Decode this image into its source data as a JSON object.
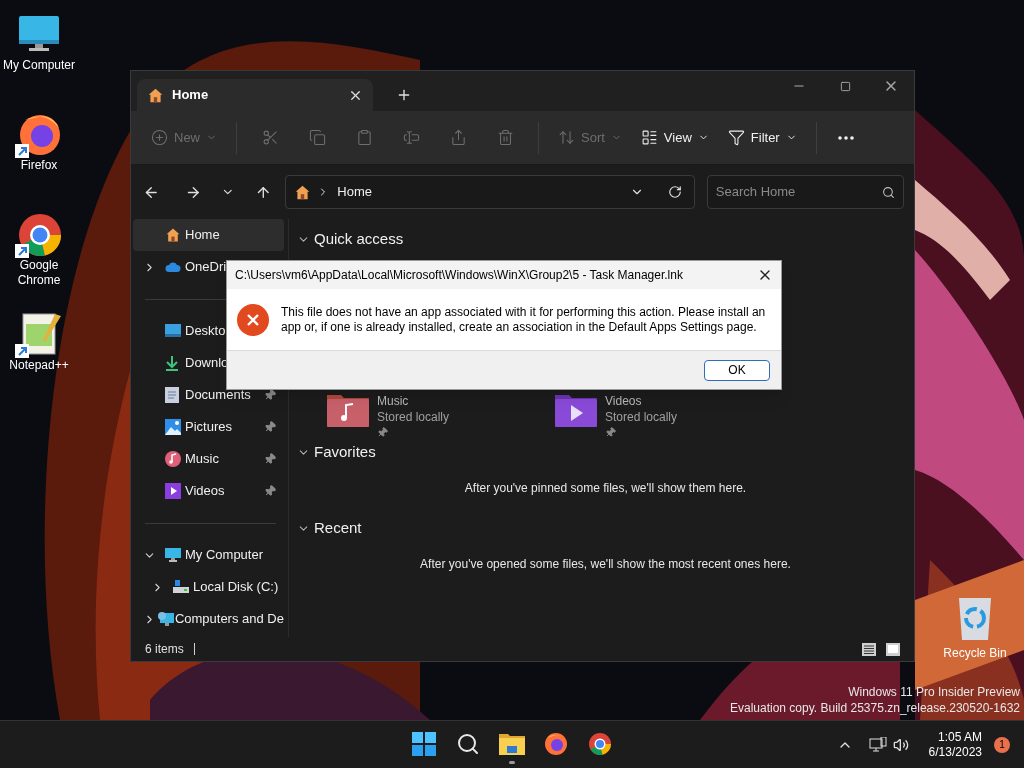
{
  "desktop_icons": [
    {
      "label": "My Computer",
      "kind": "monitor",
      "shortcut": false
    },
    {
      "label": "Firefox",
      "kind": "firefox",
      "shortcut": true
    },
    {
      "label": "Google Chrome",
      "kind": "chrome",
      "shortcut": true
    },
    {
      "label": "Notepad++",
      "kind": "notepad",
      "shortcut": true
    }
  ],
  "recycle_bin": {
    "label": "Recycle Bin"
  },
  "explorer": {
    "tab": {
      "title": "Home"
    },
    "toolbar": [
      {
        "kind": "new",
        "label": "New",
        "disabled": true
      },
      {
        "kind": "cut",
        "disabled": true
      },
      {
        "kind": "copy",
        "disabled": true
      },
      {
        "kind": "paste",
        "disabled": true
      },
      {
        "kind": "rename",
        "disabled": true
      },
      {
        "kind": "share",
        "disabled": true
      },
      {
        "kind": "delete",
        "disabled": true
      },
      {
        "kind": "sort",
        "label": "Sort",
        "disabled": true
      },
      {
        "kind": "view",
        "label": "View",
        "disabled": false
      },
      {
        "kind": "filter",
        "label": "Filter",
        "disabled": false
      },
      {
        "kind": "more",
        "disabled": false
      }
    ],
    "address": {
      "path": "Home"
    },
    "search": {
      "placeholder": "Search Home"
    },
    "sidebar": [
      {
        "items": [
          {
            "label": "Home",
            "kind": "home",
            "selected": true,
            "pinned": false
          },
          {
            "label": "OneDri",
            "kind": "cloud",
            "expanded": false,
            "selected": false,
            "pinned": false
          }
        ]
      },
      {
        "items": [
          {
            "label": "Deskto",
            "kind": "desktop",
            "selected": false,
            "pinned": false
          },
          {
            "label": "Downlo",
            "kind": "download",
            "selected": false,
            "pinned": false
          },
          {
            "label": "Documents",
            "kind": "document",
            "selected": false,
            "pinned": true
          },
          {
            "label": "Pictures",
            "kind": "pictures",
            "selected": false,
            "pinned": true
          },
          {
            "label": "Music",
            "kind": "music",
            "selected": false,
            "pinned": true
          },
          {
            "label": "Videos",
            "kind": "videos",
            "selected": false,
            "pinned": true
          }
        ]
      },
      {
        "items": [
          {
            "label": "My Computer",
            "kind": "computer",
            "expanded": true,
            "selected": false,
            "pinned": false,
            "children": [
              {
                "label": "Local Disk (C:)",
                "kind": "disk",
                "expanded": false,
                "selected": false,
                "pinned": false
              }
            ]
          },
          {
            "label": "Computers and De",
            "kind": "network",
            "expanded": false,
            "selected": false,
            "pinned": false
          }
        ]
      }
    ],
    "sections": [
      {
        "title": "Quick access",
        "expanded": true,
        "kind": "folders",
        "folders": [
          {
            "name": "Music",
            "detail": "Stored locally",
            "kind": "music",
            "pinned": true
          },
          {
            "name": "Videos",
            "detail": "Stored locally",
            "kind": "videos",
            "pinned": true
          }
        ]
      },
      {
        "title": "Favorites",
        "expanded": true,
        "kind": "message",
        "message": "After you've pinned some files, we'll show them here."
      },
      {
        "title": "Recent",
        "expanded": true,
        "kind": "message",
        "message": "After you've opened some files, we'll show the most recent ones here."
      }
    ],
    "status": "6 items"
  },
  "dialog": {
    "title": "C:\\Users\\vm6\\AppData\\Local\\Microsoft\\Windows\\WinX\\Group2\\5 - Task Manager.lnk",
    "message": "This file does not have an app associated with it for performing this action. Please install an app or, if one is already installed, create an association in the Default Apps Settings page.",
    "button": "OK"
  },
  "os_notice": [
    "Windows 11 Pro Insider Preview",
    "Evaluation copy. Build 25375.zn_release.230520-1632"
  ],
  "taskbar": {
    "apps": [
      {
        "kind": "start",
        "running": false
      },
      {
        "kind": "search",
        "running": false
      },
      {
        "kind": "folder",
        "running": true
      },
      {
        "kind": "firefox",
        "running": false
      },
      {
        "kind": "chrome",
        "running": false
      }
    ],
    "clock": {
      "time": "1:05 AM",
      "date": "6/13/2023"
    },
    "notification_count": "1"
  }
}
